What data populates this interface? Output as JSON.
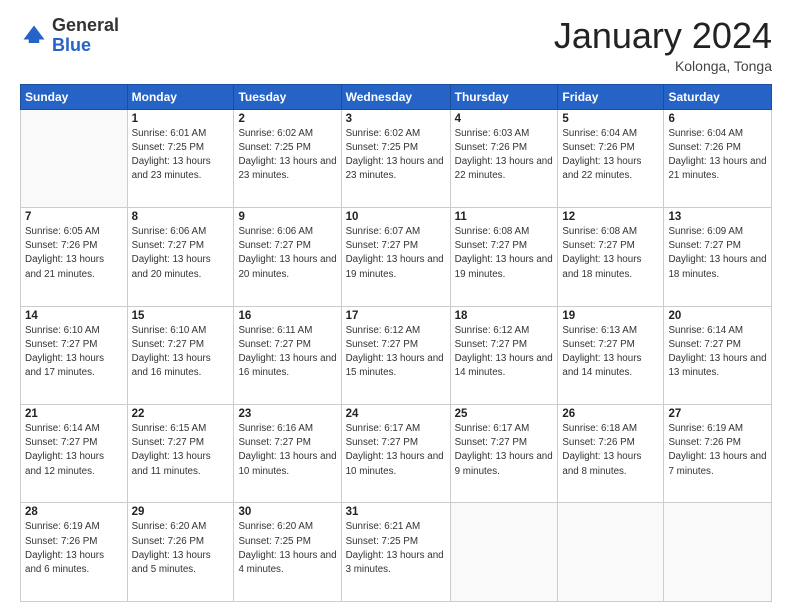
{
  "logo": {
    "general": "General",
    "blue": "Blue"
  },
  "header": {
    "month": "January 2024",
    "location": "Kolonga, Tonga"
  },
  "weekdays": [
    "Sunday",
    "Monday",
    "Tuesday",
    "Wednesday",
    "Thursday",
    "Friday",
    "Saturday"
  ],
  "weeks": [
    [
      {
        "day": "",
        "sunrise": "",
        "sunset": "",
        "daylight": ""
      },
      {
        "day": "1",
        "sunrise": "6:01 AM",
        "sunset": "7:25 PM",
        "daylight": "13 hours and 23 minutes."
      },
      {
        "day": "2",
        "sunrise": "6:02 AM",
        "sunset": "7:25 PM",
        "daylight": "13 hours and 23 minutes."
      },
      {
        "day": "3",
        "sunrise": "6:02 AM",
        "sunset": "7:25 PM",
        "daylight": "13 hours and 23 minutes."
      },
      {
        "day": "4",
        "sunrise": "6:03 AM",
        "sunset": "7:26 PM",
        "daylight": "13 hours and 22 minutes."
      },
      {
        "day": "5",
        "sunrise": "6:04 AM",
        "sunset": "7:26 PM",
        "daylight": "13 hours and 22 minutes."
      },
      {
        "day": "6",
        "sunrise": "6:04 AM",
        "sunset": "7:26 PM",
        "daylight": "13 hours and 21 minutes."
      }
    ],
    [
      {
        "day": "7",
        "sunrise": "6:05 AM",
        "sunset": "7:26 PM",
        "daylight": "13 hours and 21 minutes."
      },
      {
        "day": "8",
        "sunrise": "6:06 AM",
        "sunset": "7:27 PM",
        "daylight": "13 hours and 20 minutes."
      },
      {
        "day": "9",
        "sunrise": "6:06 AM",
        "sunset": "7:27 PM",
        "daylight": "13 hours and 20 minutes."
      },
      {
        "day": "10",
        "sunrise": "6:07 AM",
        "sunset": "7:27 PM",
        "daylight": "13 hours and 19 minutes."
      },
      {
        "day": "11",
        "sunrise": "6:08 AM",
        "sunset": "7:27 PM",
        "daylight": "13 hours and 19 minutes."
      },
      {
        "day": "12",
        "sunrise": "6:08 AM",
        "sunset": "7:27 PM",
        "daylight": "13 hours and 18 minutes."
      },
      {
        "day": "13",
        "sunrise": "6:09 AM",
        "sunset": "7:27 PM",
        "daylight": "13 hours and 18 minutes."
      }
    ],
    [
      {
        "day": "14",
        "sunrise": "6:10 AM",
        "sunset": "7:27 PM",
        "daylight": "13 hours and 17 minutes."
      },
      {
        "day": "15",
        "sunrise": "6:10 AM",
        "sunset": "7:27 PM",
        "daylight": "13 hours and 16 minutes."
      },
      {
        "day": "16",
        "sunrise": "6:11 AM",
        "sunset": "7:27 PM",
        "daylight": "13 hours and 16 minutes."
      },
      {
        "day": "17",
        "sunrise": "6:12 AM",
        "sunset": "7:27 PM",
        "daylight": "13 hours and 15 minutes."
      },
      {
        "day": "18",
        "sunrise": "6:12 AM",
        "sunset": "7:27 PM",
        "daylight": "13 hours and 14 minutes."
      },
      {
        "day": "19",
        "sunrise": "6:13 AM",
        "sunset": "7:27 PM",
        "daylight": "13 hours and 14 minutes."
      },
      {
        "day": "20",
        "sunrise": "6:14 AM",
        "sunset": "7:27 PM",
        "daylight": "13 hours and 13 minutes."
      }
    ],
    [
      {
        "day": "21",
        "sunrise": "6:14 AM",
        "sunset": "7:27 PM",
        "daylight": "13 hours and 12 minutes."
      },
      {
        "day": "22",
        "sunrise": "6:15 AM",
        "sunset": "7:27 PM",
        "daylight": "13 hours and 11 minutes."
      },
      {
        "day": "23",
        "sunrise": "6:16 AM",
        "sunset": "7:27 PM",
        "daylight": "13 hours and 10 minutes."
      },
      {
        "day": "24",
        "sunrise": "6:17 AM",
        "sunset": "7:27 PM",
        "daylight": "13 hours and 10 minutes."
      },
      {
        "day": "25",
        "sunrise": "6:17 AM",
        "sunset": "7:27 PM",
        "daylight": "13 hours and 9 minutes."
      },
      {
        "day": "26",
        "sunrise": "6:18 AM",
        "sunset": "7:26 PM",
        "daylight": "13 hours and 8 minutes."
      },
      {
        "day": "27",
        "sunrise": "6:19 AM",
        "sunset": "7:26 PM",
        "daylight": "13 hours and 7 minutes."
      }
    ],
    [
      {
        "day": "28",
        "sunrise": "6:19 AM",
        "sunset": "7:26 PM",
        "daylight": "13 hours and 6 minutes."
      },
      {
        "day": "29",
        "sunrise": "6:20 AM",
        "sunset": "7:26 PM",
        "daylight": "13 hours and 5 minutes."
      },
      {
        "day": "30",
        "sunrise": "6:20 AM",
        "sunset": "7:25 PM",
        "daylight": "13 hours and 4 minutes."
      },
      {
        "day": "31",
        "sunrise": "6:21 AM",
        "sunset": "7:25 PM",
        "daylight": "13 hours and 3 minutes."
      },
      {
        "day": "",
        "sunrise": "",
        "sunset": "",
        "daylight": ""
      },
      {
        "day": "",
        "sunrise": "",
        "sunset": "",
        "daylight": ""
      },
      {
        "day": "",
        "sunrise": "",
        "sunset": "",
        "daylight": ""
      }
    ]
  ],
  "labels": {
    "sunrise": "Sunrise:",
    "sunset": "Sunset:",
    "daylight": "Daylight:"
  },
  "colors": {
    "header_bg": "#2563c7",
    "alt_row": "#f5f5f5"
  }
}
